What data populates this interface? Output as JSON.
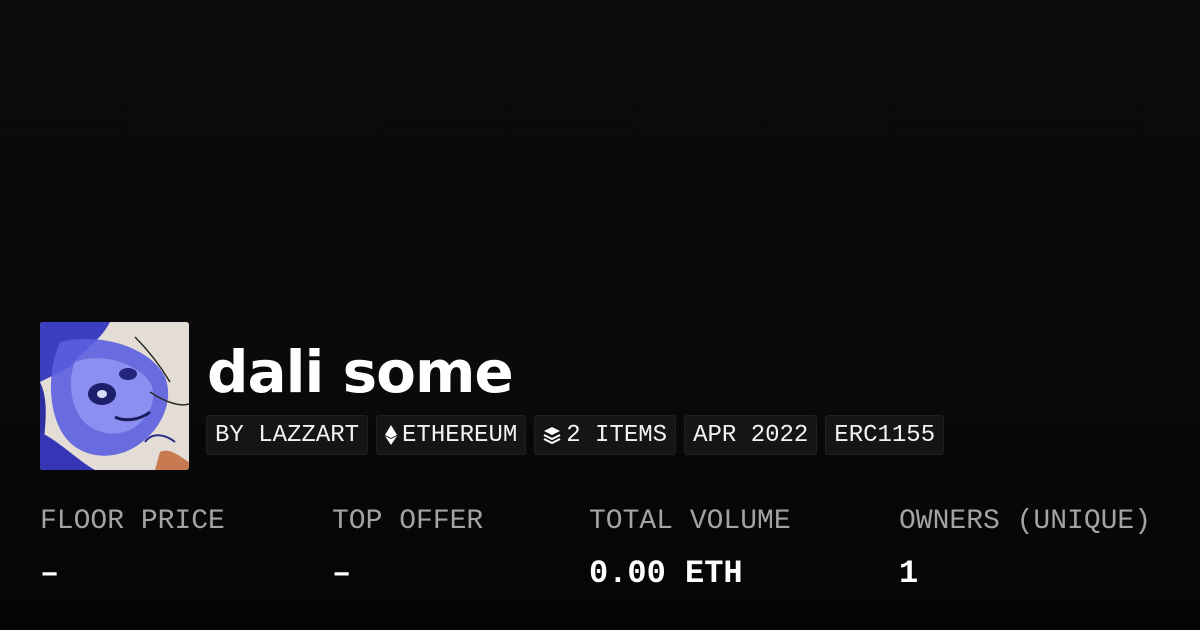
{
  "collection": {
    "title": "dali some",
    "avatar_alt": "collection-avatar"
  },
  "tags": {
    "creator": "BY LAZZART",
    "chain": "ETHEREUM",
    "chain_icon": "ethereum-icon",
    "items": "2 ITEMS",
    "items_icon": "layers-icon",
    "date": "APR 2022",
    "standard": "ERC1155"
  },
  "stats": {
    "floor_price": {
      "label": "FLOOR PRICE",
      "value": "–"
    },
    "top_offer": {
      "label": "TOP OFFER",
      "value": "–"
    },
    "total_volume": {
      "label": "TOTAL VOLUME",
      "value": "0.00 ETH"
    },
    "owners": {
      "label": "OWNERS (UNIQUE)",
      "value": "1"
    }
  },
  "colors": {
    "background": "#0a0a0a",
    "tag_background": "#151515",
    "label_gray": "#a3a3a3",
    "text": "#ffffff",
    "avatar_accent": "#3b3fd0"
  }
}
